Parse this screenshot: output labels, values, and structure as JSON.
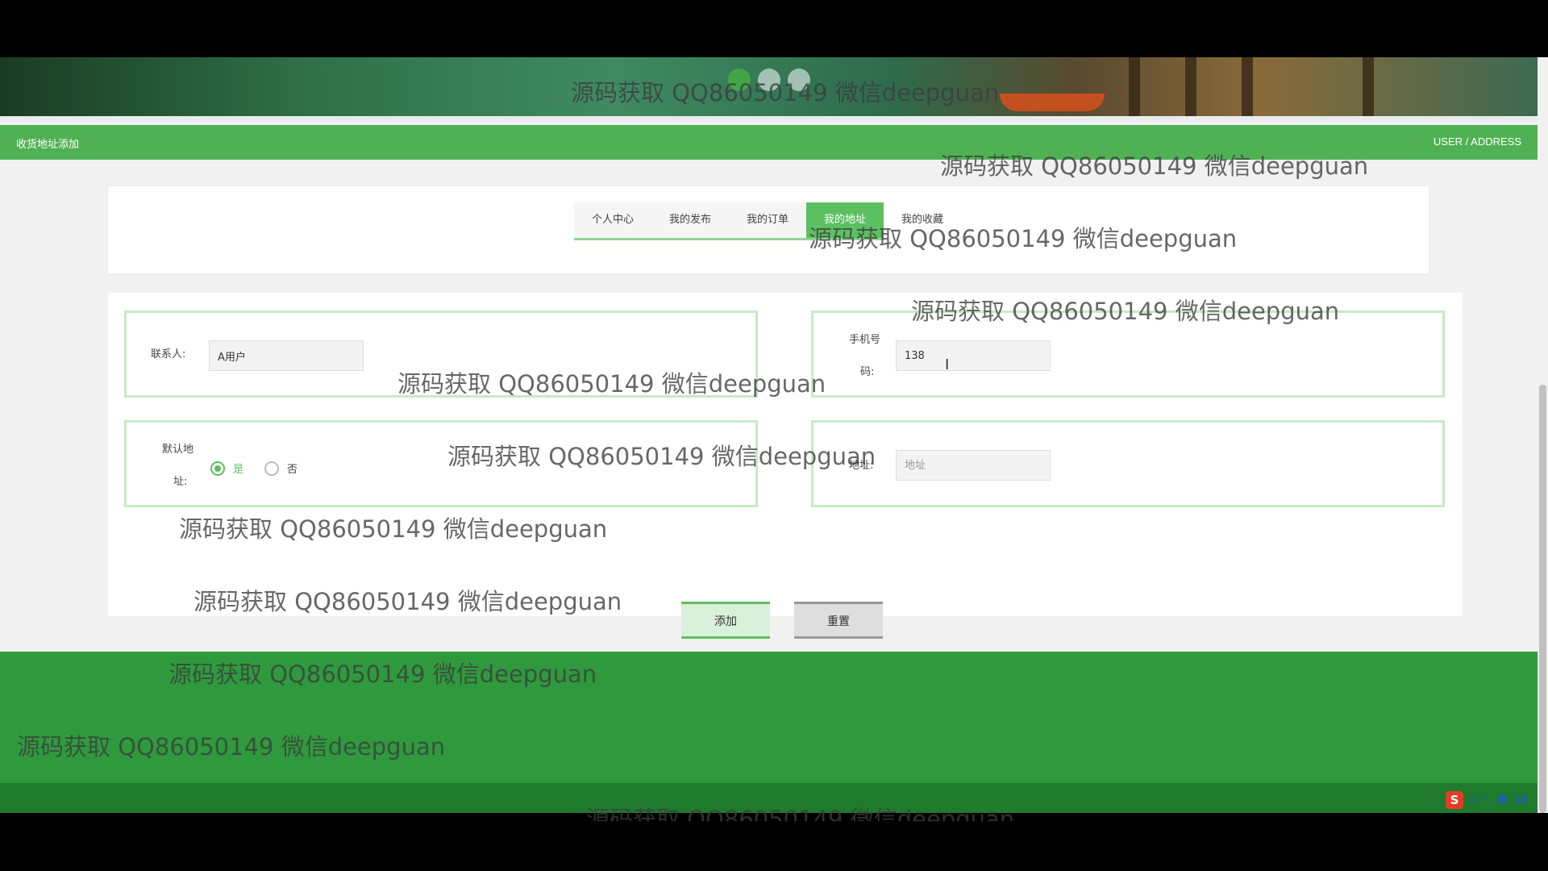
{
  "header": {
    "title": "收货地址添加",
    "breadcrumb": "USER / ADDRESS"
  },
  "tabs": [
    "个人中心",
    "我的发布",
    "我的订单",
    "我的地址",
    "我的收藏"
  ],
  "form": {
    "contact": {
      "label": "联系人:",
      "value": "A用户"
    },
    "phone": {
      "label_line1": "手机号",
      "label_line2": "码:",
      "value": "138"
    },
    "default": {
      "label_line1": "默认地",
      "label_line2": "址:",
      "option_yes": "是",
      "option_no": "否",
      "selected": "是"
    },
    "address": {
      "label": "地址:",
      "placeholder": "地址"
    }
  },
  "buttons": {
    "add": "添加",
    "reset": "重置"
  },
  "watermark": "源码获取 QQ86050149 微信deepguan",
  "ime": {
    "mode": "中",
    "punct": "°,",
    "s_label": "S"
  },
  "colors": {
    "primary_green": "#50b154",
    "footer_green": "#2e9a3d",
    "footer_dark": "#1f7a2d"
  }
}
